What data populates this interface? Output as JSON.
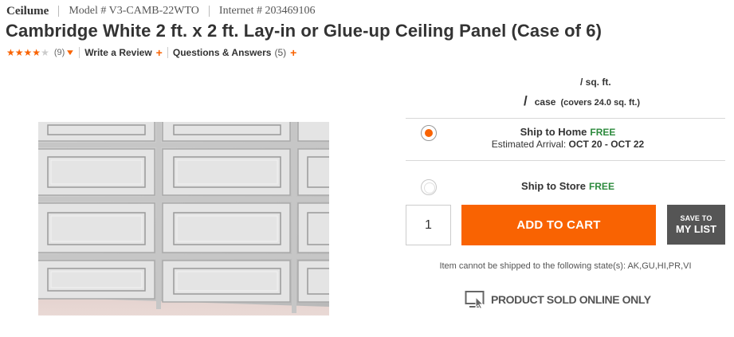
{
  "meta": {
    "brand": "Ceilume",
    "model": "Model # V3-CAMB-22WTO",
    "internet": "Internet # 203469106"
  },
  "title": "Cambridge White 2 ft. x 2 ft. Lay-in or Glue-up Ceiling Panel (Case of 6)",
  "rating": {
    "stars": 4,
    "max": 5,
    "count": "(9)"
  },
  "review_link": "Write a Review",
  "qa_link": "Questions & Answers",
  "qa_count": "(5)",
  "pricing": {
    "per_sqft": "/ sq. ft.",
    "slash": "/",
    "unit": "case",
    "coverage": "(covers 24.0 sq. ft.)"
  },
  "ship_home": {
    "label": "Ship to Home",
    "free": "FREE",
    "arrival_label": "Estimated Arrival:",
    "arrival_dates": "OCT 20 - OCT 22",
    "selected": true
  },
  "ship_store": {
    "label": "Ship to Store",
    "free": "FREE",
    "selected": false
  },
  "quantity": "1",
  "add_to_cart": "ADD TO CART",
  "save_to": "SAVE TO",
  "my_list": "MY LIST",
  "restriction": "Item cannot be shipped to the following state(s): AK,GU,HI,PR,VI",
  "sold_online": "PRODUCT SOLD ONLINE ONLY",
  "colors": {
    "accent": "#f96302",
    "free_green": "#2c8a3d",
    "save_button": "#555555"
  },
  "icons": {
    "star": "star-icon",
    "chevron": "chevron-down-icon",
    "plus": "plus-icon",
    "online": "monitor-cursor-icon"
  }
}
